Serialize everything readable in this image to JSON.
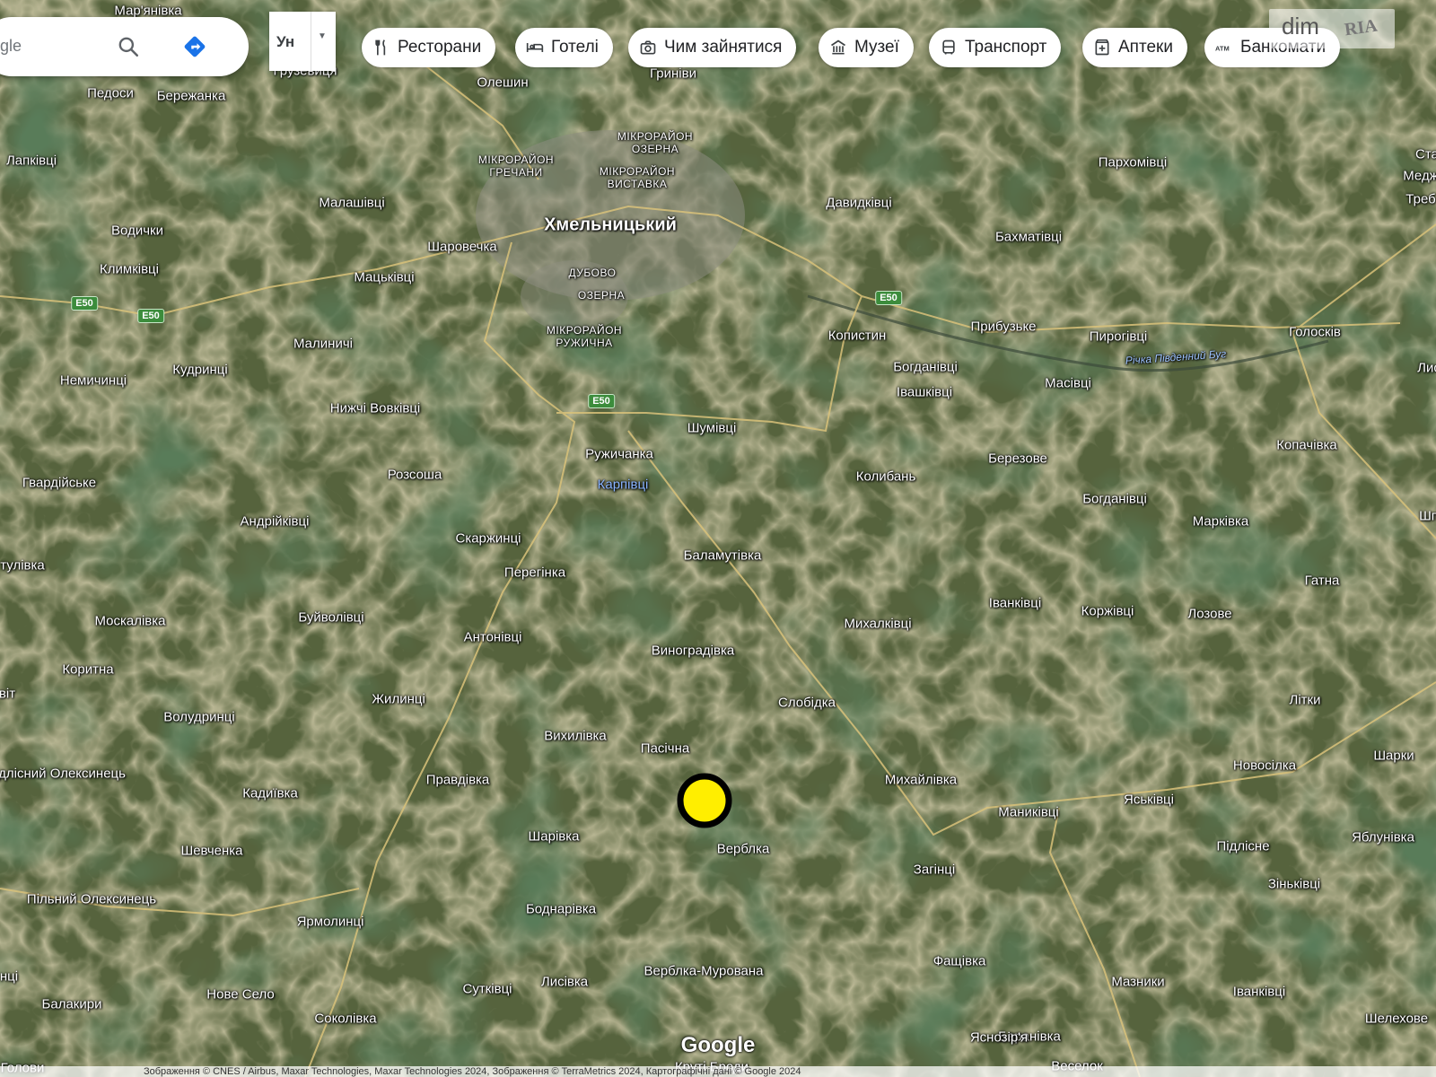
{
  "search": {
    "visible_text": "gle"
  },
  "layer_toggle": {
    "label": "Ун"
  },
  "categories": [
    {
      "label": "Ресторани",
      "icon": "fork-knife-icon"
    },
    {
      "label": "Готелі",
      "icon": "bed-icon"
    },
    {
      "label": "Чим зайнятися",
      "icon": "camera-icon"
    },
    {
      "label": "Музеї",
      "icon": "museum-icon"
    },
    {
      "label": "Транспорт",
      "icon": "bus-icon"
    },
    {
      "label": "Аптеки",
      "icon": "pharmacy-icon"
    },
    {
      "label": "Банкомати",
      "icon": "atm-icon"
    }
  ],
  "logo": {
    "text1": "dim",
    "text2": "RIA"
  },
  "map": {
    "places": [
      {
        "name": "Мар'янівка"
      },
      {
        "name": "Грузевиця"
      },
      {
        "name": "Олешин"
      },
      {
        "name": "Гриніви"
      },
      {
        "name": "Педоси"
      },
      {
        "name": "Бережанка"
      },
      {
        "name": "Лапківці"
      },
      {
        "name": "Малашівці"
      },
      {
        "name": "Водички"
      },
      {
        "name": "Климківці"
      },
      {
        "name": "Шаровечка"
      },
      {
        "name": "Мацьківці"
      },
      {
        "name": "Давидківці"
      },
      {
        "name": "Бахматівці"
      },
      {
        "name": "Пархомівці"
      },
      {
        "name": "Малиничі"
      },
      {
        "name": "Копистин"
      },
      {
        "name": "Прибузьке"
      },
      {
        "name": "Пирогівці"
      },
      {
        "name": "Голосків"
      },
      {
        "name": "Немичинці"
      },
      {
        "name": "Кудринці"
      },
      {
        "name": "Богданівці"
      },
      {
        "name": "Івашківці"
      },
      {
        "name": "Масівці"
      },
      {
        "name": "Нижчі Вовківці"
      },
      {
        "name": "Шумівці"
      },
      {
        "name": "Ружичанка"
      },
      {
        "name": "Гвардійське"
      },
      {
        "name": "Розсоша"
      },
      {
        "name": "Березове"
      },
      {
        "name": "Колибань"
      },
      {
        "name": "Копачівка"
      },
      {
        "name": "Андрійківці"
      },
      {
        "name": "Скаржинці"
      },
      {
        "name": "Богданівці"
      },
      {
        "name": "Марківка"
      },
      {
        "name": "Перегінка"
      },
      {
        "name": "Баламутівка"
      },
      {
        "name": "тулівка"
      },
      {
        "name": "Гатна"
      },
      {
        "name": "Іванківці"
      },
      {
        "name": "Коржівці"
      },
      {
        "name": "Лозове"
      },
      {
        "name": "Москалівка"
      },
      {
        "name": "Буйволівці"
      },
      {
        "name": "Антонівці"
      },
      {
        "name": "Михалківці"
      },
      {
        "name": "Виноградівка"
      },
      {
        "name": "Коритна"
      },
      {
        "name": "Волудринці"
      },
      {
        "name": "Жилинці"
      },
      {
        "name": "Слобідка"
      },
      {
        "name": "Літки"
      },
      {
        "name": "Вихилівка"
      },
      {
        "name": "Пасічна"
      },
      {
        "name": "Підлісний Олексинець"
      },
      {
        "name": "Правдівка"
      },
      {
        "name": "Михайлівка"
      },
      {
        "name": "Новосілка"
      },
      {
        "name": "Шарки"
      },
      {
        "name": "Кадиївка"
      },
      {
        "name": "Маниківці"
      },
      {
        "name": "Яськівці"
      },
      {
        "name": "Шарівка"
      },
      {
        "name": "Верблка"
      },
      {
        "name": "Шевченка"
      },
      {
        "name": "Підлісне"
      },
      {
        "name": "Яблунівка"
      },
      {
        "name": "Загінці"
      },
      {
        "name": "Пільний Олексинець"
      },
      {
        "name": "Зіньківці"
      },
      {
        "name": "Ярмолинці"
      },
      {
        "name": "Боднарівка"
      },
      {
        "name": "Верблка-Мурована"
      },
      {
        "name": "Фащівка"
      },
      {
        "name": "Нове Село"
      },
      {
        "name": "Балакири"
      },
      {
        "name": "Сутківці"
      },
      {
        "name": "Лисівка"
      },
      {
        "name": "Мазники"
      },
      {
        "name": "Іванківці"
      },
      {
        "name": "Соколівка"
      },
      {
        "name": "Шелехове"
      },
      {
        "name": "Баранівка"
      },
      {
        "name": "Яснозір'я"
      },
      {
        "name": "Крутi Броди"
      },
      {
        "name": "Веселок"
      },
      {
        "name": "Голови"
      },
      {
        "name": "Медж"
      },
      {
        "name": "Треб"
      },
      {
        "name": "Ста"
      },
      {
        "name": "Лис"
      },
      {
        "name": "Шп"
      },
      {
        "name": "віт"
      },
      {
        "name": "нці"
      }
    ],
    "districts": [
      {
        "name": "МІКРОРАЙОН ОЗЕРНА"
      },
      {
        "name": "МІКРОРАЙОН ГРЕЧАНИ"
      },
      {
        "name": "МІКРОРАЙОН ВИСТАВКА"
      },
      {
        "name": "ДУБОВО"
      },
      {
        "name": "ОЗЕРНА"
      },
      {
        "name": "МІКРОРАЙОН РУЖИЧНА"
      }
    ],
    "city": "Хмельницький",
    "river": "Річка Південний Буг",
    "highlight_place": "Карпівці",
    "road_shields": [
      "E50",
      "E50",
      "E50",
      "E50"
    ]
  },
  "marker": {
    "fill": "#ffee00",
    "stroke": "#000000"
  },
  "branding": {
    "google": "Google"
  },
  "footer": {
    "text": "Зображення © CNES / Airbus, Maxar Technologies, Maxar Technologies 2024, Зображення © TerraMetrics 2024, Картографічні дані © Google 2024"
  }
}
